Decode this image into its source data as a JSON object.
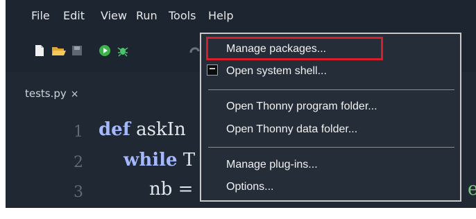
{
  "menubar": {
    "items": [
      "File",
      "Edit",
      "View",
      "Run",
      "Tools",
      "Help"
    ]
  },
  "toolbar": {
    "icons": [
      "new-file-icon",
      "open-folder-icon",
      "save-icon",
      "run-icon",
      "debug-icon"
    ]
  },
  "tab": {
    "label": "tests.py",
    "close": "×"
  },
  "editor": {
    "line_numbers": [
      "1",
      "2",
      "3"
    ],
    "lines": [
      {
        "kw": "def",
        "text": " askIn"
      },
      {
        "kw": "while",
        "text": " T"
      },
      {
        "text": "nb ="
      }
    ]
  },
  "tools_menu": {
    "items": [
      "Manage packages...",
      "Open system shell...",
      "Open Thonny program folder...",
      "Open Thonny data folder...",
      "Manage plug-ins...",
      "Options..."
    ],
    "highlight_color": "#d81e28"
  }
}
